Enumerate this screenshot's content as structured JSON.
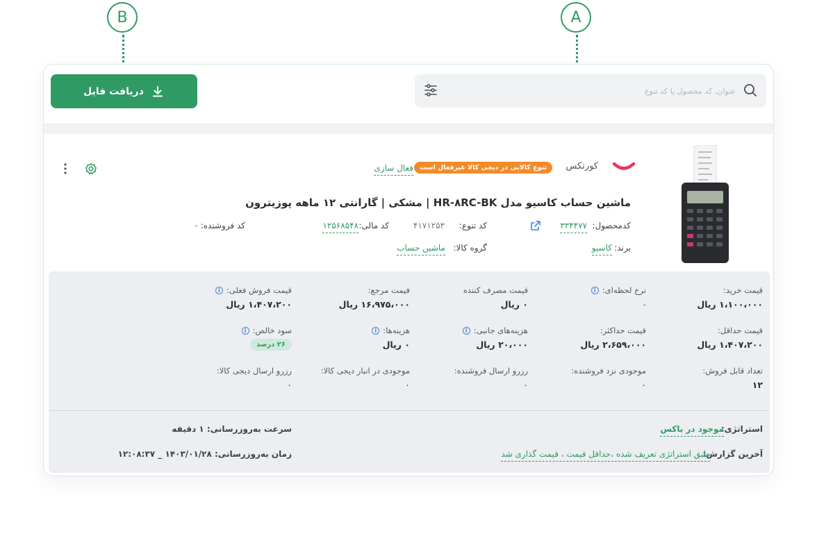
{
  "callouts": {
    "a": "A",
    "b": "B"
  },
  "toolbar": {
    "download_label": "دریافت فایل",
    "search_placeholder": "عنوان، کد محصول یا کد تنوع"
  },
  "product": {
    "brand_logo_text": "کورتکس",
    "inactive_badge": "تنوع کالایی در دیجی کالا غیرفعال است",
    "activate_link": "فعال سازی",
    "title": "ماشین حساب کاسیو مدل HR-۸RC-BK | مشکی | گارانتی ۱۲ ماهه پوزیترون",
    "product_code_label": "کدمحصول:",
    "product_code": "۳۳۴۴۷۷",
    "variant_code_label": "کد تنوع:",
    "variant_code": "۴۱۷۱۲۵۳",
    "fiscal_code_label": "کد مالی:",
    "fiscal_code": "۱۲۵۶۸۵۴۸",
    "seller_code_label": "کد فروشنده:",
    "seller_code": "-",
    "brand_label": "برند:",
    "brand": "کاسیو",
    "group_label": "گروه کالا:",
    "group": "ماشین حساب"
  },
  "details": {
    "row1": [
      {
        "label": "قیمت خرید:",
        "value": "۱،۱۰۰،۰۰۰ ریال",
        "info": false
      },
      {
        "label": "نرخ لحظه‌ای:",
        "value": "-",
        "info": true
      },
      {
        "label": "قیمت مصرف کننده",
        "value": "۰ ریال",
        "info": false
      },
      {
        "label": "قیمت مرجع:",
        "value": "۱۶،۹۷۵،۰۰۰ ریال",
        "info": false
      },
      {
        "label": "قیمت فروش فعلی:",
        "value": "۱،۴۰۷،۲۰۰ ریال",
        "info": true
      }
    ],
    "row2": [
      {
        "label": "قیمت حداقل:",
        "value": "۱،۴۰۷،۲۰۰ ریال",
        "info": false
      },
      {
        "label": "قیمت حداکثر:",
        "value": "۲،۶۵۹،۰۰۰ ریال",
        "info": false
      },
      {
        "label": "هزینه‌های جانبی:",
        "value": "۲۰،۰۰۰ ریال",
        "info": true
      },
      {
        "label": "هزینه‌ها:",
        "value": "۰ ریال",
        "info": true
      },
      {
        "label": "سود خالص:",
        "value": "۲۶ درصد",
        "info": true
      }
    ],
    "row3": [
      {
        "label": "تعداد قابل فروش:",
        "value": "۱۲"
      },
      {
        "label": "موجودی نزد فروشنده:",
        "value": "۰"
      },
      {
        "label": "رزرو ارسال فروشنده:",
        "value": "۰"
      },
      {
        "label": "موجودی در انبار دیجی کالا:",
        "value": "۰"
      },
      {
        "label": "رزرو ارسال دیجی کالا:",
        "value": "۰"
      }
    ],
    "strategy_label": "استراتژی:",
    "strategy_value": "موجود در باکس",
    "last_report_label": "آخرین گزارش:",
    "last_report_value": "طبق استراتژی تعریف شده ،حداقل قیمت ، قیمت گذاری شد",
    "update_speed": "سرعت به‌روزرسانی: ۱ دقیقه",
    "update_time": "زمان به‌روزرسانی: ۱۴۰۳/۰۱/۲۸ _ ۱۲:۰۸:۳۷"
  },
  "colors": {
    "primary": "#2f9a64",
    "badge": "#f28c28",
    "brand_logo": "#e8365d"
  },
  "icons": [
    "search-icon",
    "filter-icon",
    "download-icon",
    "settings-icon",
    "more-icon",
    "external-link-icon",
    "info-icon"
  ]
}
